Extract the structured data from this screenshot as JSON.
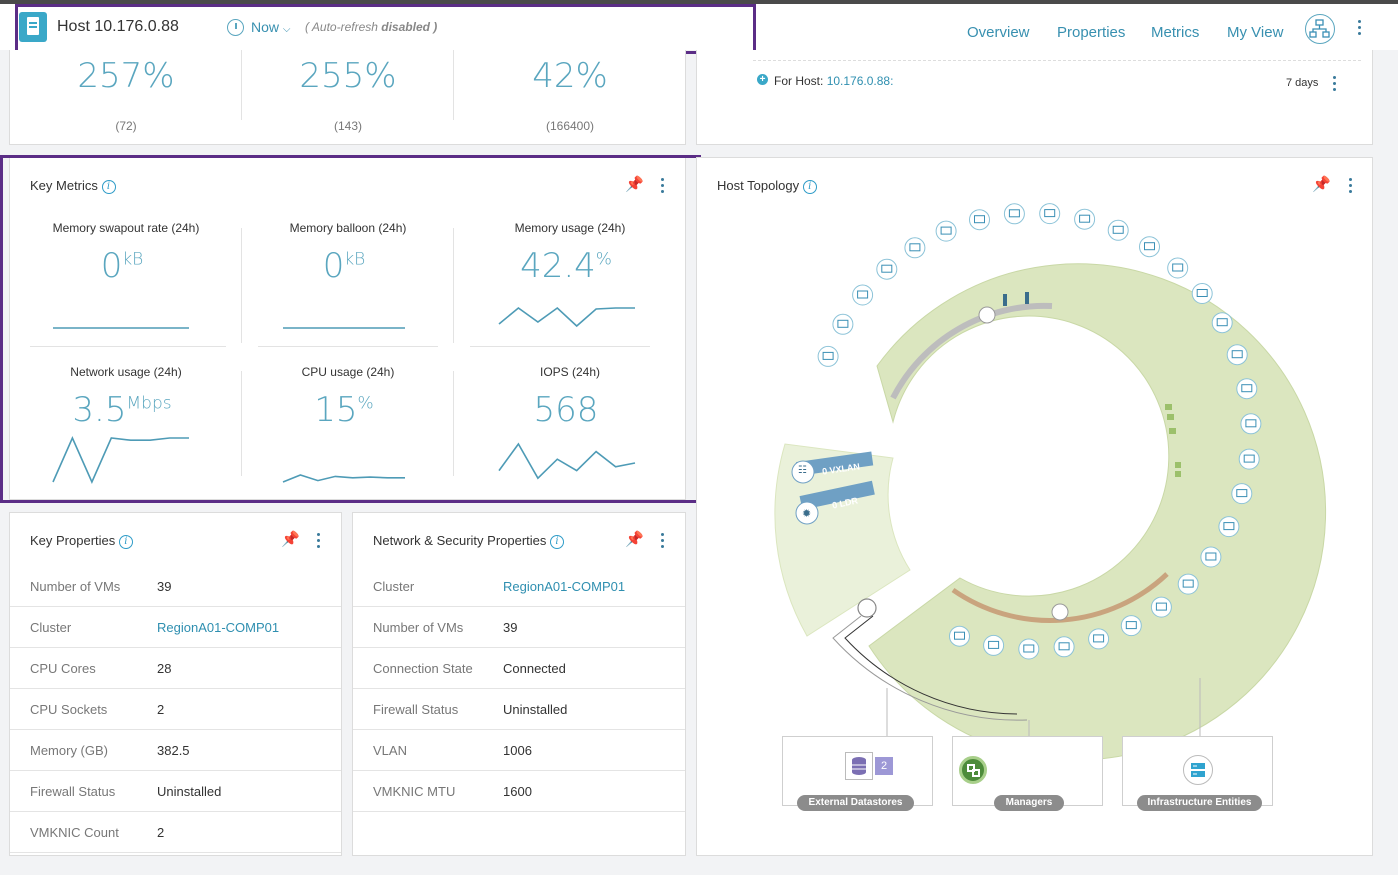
{
  "header": {
    "title": "Host 10.176.0.88",
    "time_label": "Now",
    "refresh_text": "( Auto-refresh",
    "refresh_state": "disabled )",
    "nav": [
      "Overview",
      "Properties",
      "Metrics",
      "My View"
    ]
  },
  "top_stats": [
    {
      "value": "257%",
      "count": "(72)"
    },
    {
      "value": "255%",
      "count": "(143)"
    },
    {
      "value": "42%",
      "count": "(166400)"
    }
  ],
  "alerts_panel": {
    "for_host_label": "For Host:",
    "host_link": "10.176.0.88:",
    "range": "7 days"
  },
  "key_metrics": {
    "title": "Key Metrics",
    "items": [
      {
        "label": "Memory swapout rate (24h)",
        "value": "0",
        "unit": "kB",
        "sparkline": [
          0.0,
          0.0,
          0.0,
          0.0,
          0.0,
          0.0,
          0.0,
          0.0
        ]
      },
      {
        "label": "Memory balloon (24h)",
        "value": "0",
        "unit": "kB",
        "sparkline": [
          0.0,
          0.0,
          0.0,
          0.0,
          0.0,
          0.0,
          0.0,
          0.0
        ]
      },
      {
        "label": "Memory usage (24h)",
        "value": "42.4",
        "unit": "%",
        "sparkline": [
          0.2,
          1.0,
          0.3,
          1.0,
          0.1,
          0.95,
          1.0,
          1.0
        ]
      },
      {
        "label": "Network usage (24h)",
        "value": "3.5",
        "unit": "Mbps",
        "sparkline": [
          0.0,
          1.0,
          0.0,
          1.0,
          0.95,
          0.95,
          1.0,
          1.0
        ]
      },
      {
        "label": "CPU usage (24h)",
        "value": "15",
        "unit": "%",
        "sparkline": [
          0.0,
          0.5,
          0.1,
          0.4,
          0.3,
          0.35,
          0.3,
          0.3
        ]
      },
      {
        "label": "IOPS (24h)",
        "value": "568",
        "unit": "",
        "sparkline": [
          0.3,
          1.0,
          0.1,
          0.6,
          0.3,
          0.8,
          0.4,
          0.5
        ]
      }
    ]
  },
  "key_properties": {
    "title": "Key Properties",
    "rows": [
      {
        "key": "Number of VMs",
        "value": "39",
        "link": false
      },
      {
        "key": "Cluster",
        "value": "RegionA01-COMP01",
        "link": true
      },
      {
        "key": "CPU Cores",
        "value": "28",
        "link": false
      },
      {
        "key": "CPU Sockets",
        "value": "2",
        "link": false
      },
      {
        "key": "Memory (GB)",
        "value": "382.5",
        "link": false
      },
      {
        "key": "Firewall Status",
        "value": "Uninstalled",
        "link": false
      },
      {
        "key": "VMKNIC Count",
        "value": "2",
        "link": false
      }
    ]
  },
  "network_properties": {
    "title": "Network & Security Properties",
    "rows": [
      {
        "key": "Cluster",
        "value": "RegionA01-COMP01",
        "link": true
      },
      {
        "key": "Number of VMs",
        "value": "39",
        "link": false
      },
      {
        "key": "Connection State",
        "value": "Connected",
        "link": false
      },
      {
        "key": "Firewall Status",
        "value": "Uninstalled",
        "link": false
      },
      {
        "key": "VLAN",
        "value": "1006",
        "link": false
      },
      {
        "key": "VMKNIC MTU",
        "value": "1600",
        "link": false
      }
    ]
  },
  "topology": {
    "title": "Host Topology",
    "vxlan_label": "0 VXLAN",
    "ldr_label": "0 LDR",
    "boxes": [
      {
        "label": "External Datastores",
        "badge": "2"
      },
      {
        "label": "Managers",
        "badge": ""
      },
      {
        "label": "Infrastructure Entities",
        "badge": ""
      }
    ]
  },
  "colors": {
    "accent": "#3d8fa8",
    "highlight": "#5b2d86",
    "ring": "#dbe6bf"
  }
}
